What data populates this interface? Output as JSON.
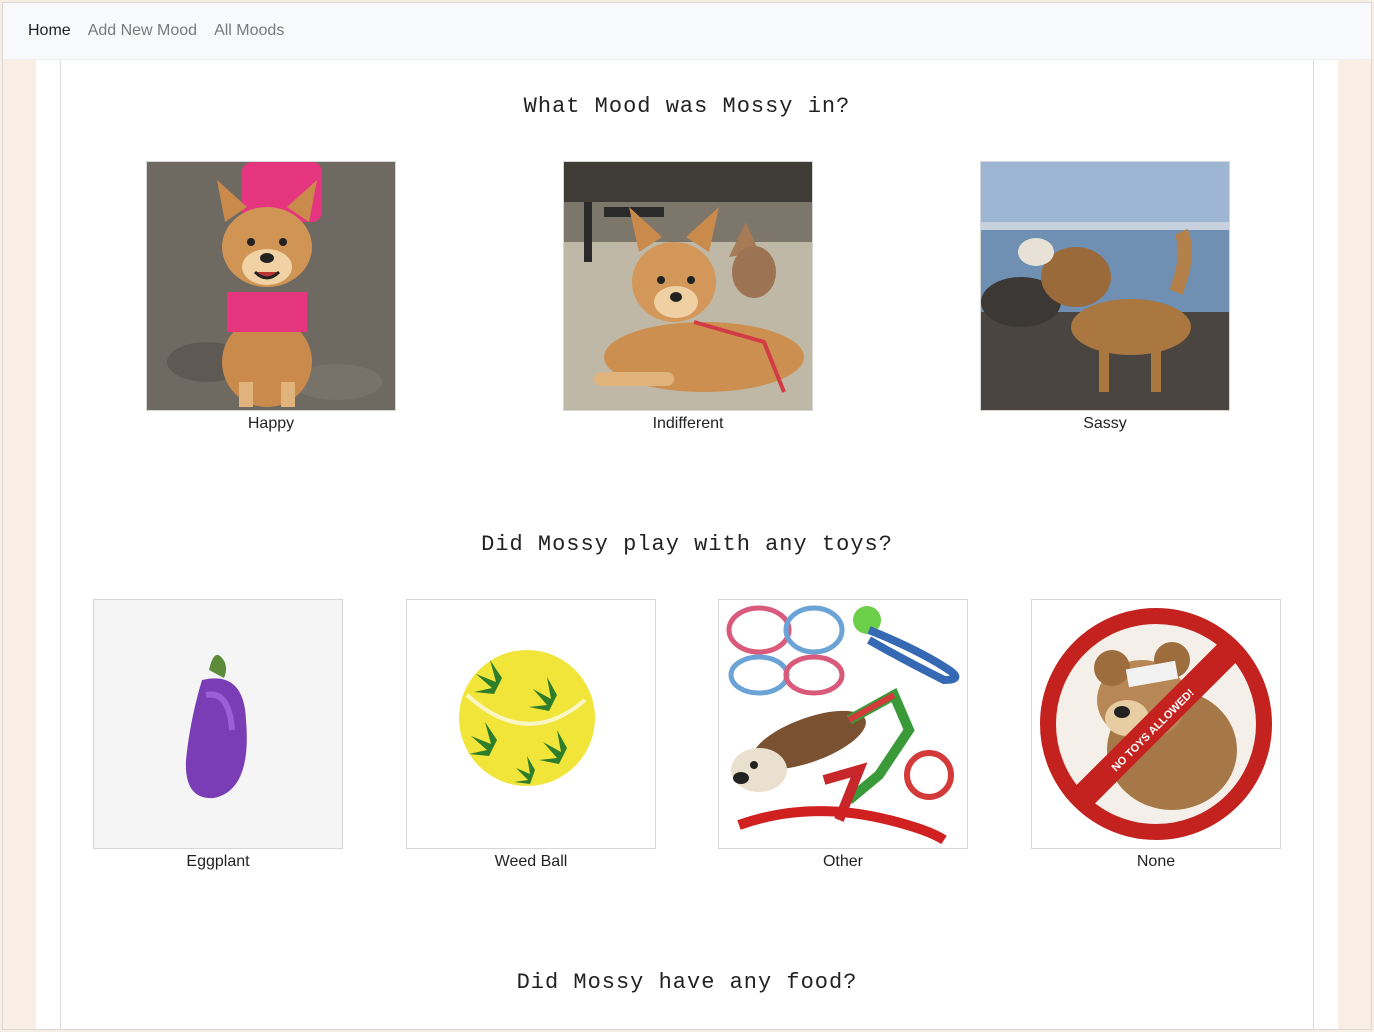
{
  "nav": {
    "items": [
      {
        "label": "Home"
      },
      {
        "label": "Add New Mood"
      },
      {
        "label": "All Moods"
      }
    ]
  },
  "sections": {
    "mood": {
      "title": "What Mood was Mossy in?",
      "options": [
        {
          "label": "Happy",
          "icon": "dog-happy-photo"
        },
        {
          "label": "Indifferent",
          "icon": "dog-indifferent-photo"
        },
        {
          "label": "Sassy",
          "icon": "dog-sassy-photo"
        }
      ]
    },
    "toys": {
      "title": "Did Mossy play with any toys?",
      "options": [
        {
          "label": "Eggplant",
          "icon": "eggplant-toy-image"
        },
        {
          "label": "Weed Ball",
          "icon": "weed-ball-toy-image"
        },
        {
          "label": "Other",
          "icon": "assorted-toys-image"
        },
        {
          "label": "None",
          "icon": "no-toys-image",
          "badge_text": "NO TOYS ALLOWED!"
        }
      ]
    },
    "food": {
      "title": "Did Mossy have any food?"
    }
  },
  "colors": {
    "page_background": "#f8eee4",
    "navbar_background": "#f8f9fa",
    "nav_active": "#222222",
    "nav_inactive": "#7a7a7a",
    "no_toys_red": "#c4221f"
  }
}
